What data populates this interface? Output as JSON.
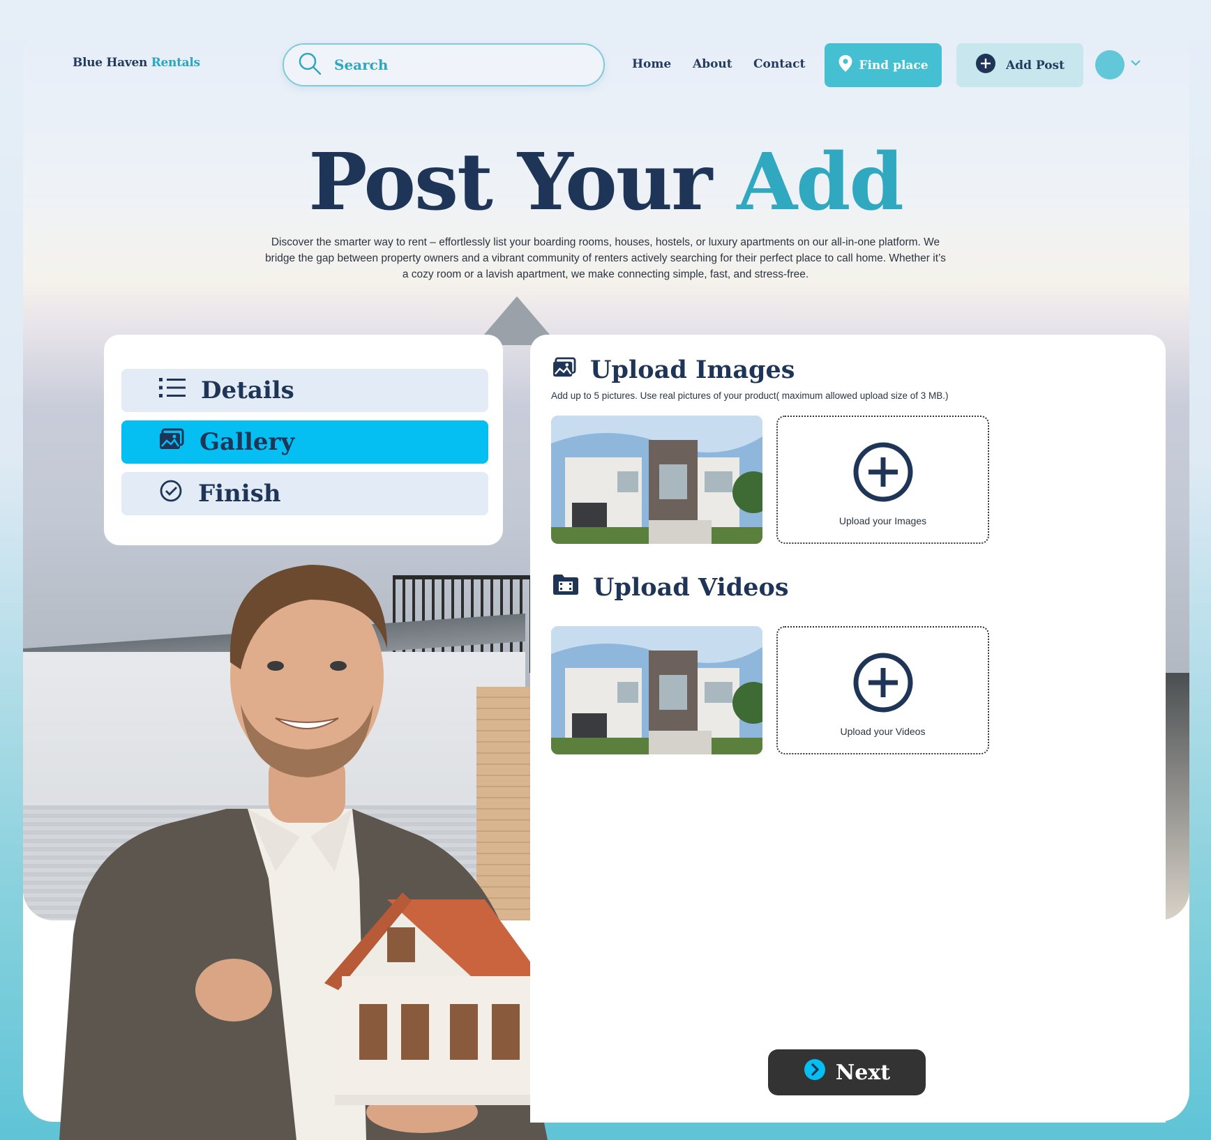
{
  "brand": {
    "name_part1": "Blue Haven",
    "name_part2": "Rentals"
  },
  "search": {
    "placeholder": "Search",
    "icon": "search-icon"
  },
  "nav": {
    "home": "Home",
    "about": "About",
    "contact": "Contact"
  },
  "buttons": {
    "find_place": "Find place",
    "add_post": "Add Post",
    "next": "Next"
  },
  "hero": {
    "title_main": "Post Your",
    "title_accent": "Add",
    "description": "Discover the smarter way to rent – effortlessly list your boarding rooms, houses, hostels, or luxury apartments on our all-in-one platform. We bridge the gap between property owners and a vibrant community of renters actively searching for their perfect place to call home. Whether it’s a cozy room or a lavish apartment, we make connecting simple, fast, and stress-free."
  },
  "steps": [
    {
      "label": "Details",
      "icon": "list-icon",
      "active": false
    },
    {
      "label": "Gallery",
      "icon": "gallery-icon",
      "active": true
    },
    {
      "label": "Finish",
      "icon": "check-circle-icon",
      "active": false
    }
  ],
  "upload_images": {
    "title": "Upload Images",
    "subtitle": "Add up to 5 pictures. Use real pictures of your product( maximum allowed upload size of 3 MB.)",
    "drop_label": "Upload your Images"
  },
  "upload_videos": {
    "title": "Upload Videos",
    "drop_label": "Upload your Videos"
  },
  "colors": {
    "accent": "#2fa8c0",
    "navy": "#1f3558",
    "active_step": "#05bff2",
    "next_button": "#333333"
  }
}
